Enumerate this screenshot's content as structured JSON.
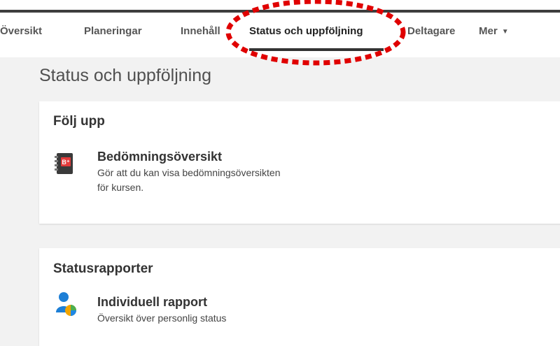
{
  "nav": {
    "tabs": [
      {
        "label": "Översikt"
      },
      {
        "label": "Planeringar"
      },
      {
        "label": "Innehåll"
      },
      {
        "label": "Status och uppföljning"
      },
      {
        "label": "Deltagare"
      },
      {
        "label": "Mer"
      }
    ],
    "active_tab": "Status och uppföljning"
  },
  "page": {
    "title": "Status och uppföljning"
  },
  "sections": [
    {
      "title": "Följ upp",
      "items": [
        {
          "title": "Bedömningsöversikt",
          "description_line1": "Gör att du kan visa bedömningsöversikten",
          "description_line2": "för kursen.",
          "icon": "gradebook-icon"
        }
      ]
    },
    {
      "title": "Statusrapporter",
      "items": [
        {
          "title": "Individuell rapport",
          "description_line1": "Översikt över personlig status",
          "icon": "user-report-icon"
        }
      ]
    }
  ],
  "colors": {
    "background": "#f2f2f2",
    "card": "#ffffff",
    "annotation": "#e00000",
    "text": "#333333"
  }
}
